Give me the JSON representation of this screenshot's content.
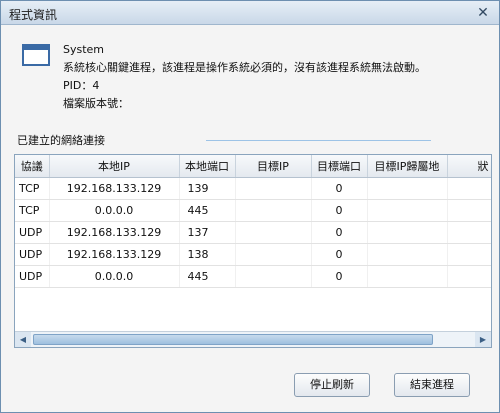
{
  "window": {
    "title": "程式資訊"
  },
  "process": {
    "name": "System",
    "description": "系統核心關鍵進程，該進程是操作系統必須的，沒有該進程系統無法啟動。",
    "pid_text": "PID：4",
    "version_label": "檔案版本號："
  },
  "connections": {
    "section_label": "已建立的網絡連接",
    "columns": [
      "協議",
      "本地IP",
      "本地端口",
      "目標IP",
      "目標端口",
      "目標IP歸屬地",
      "狀"
    ],
    "rows": [
      [
        "TCP",
        "192.168.133.129",
        "139",
        "",
        "0",
        "",
        ""
      ],
      [
        "TCP",
        "0.0.0.0",
        "445",
        "",
        "0",
        "",
        ""
      ],
      [
        "UDP",
        "192.168.133.129",
        "137",
        "",
        "0",
        "",
        ""
      ],
      [
        "UDP",
        "192.168.133.129",
        "138",
        "",
        "0",
        "",
        ""
      ],
      [
        "UDP",
        "0.0.0.0",
        "445",
        "",
        "0",
        "",
        ""
      ]
    ]
  },
  "buttons": {
    "stop_refresh": "停止刷新",
    "end_process": "結束進程"
  },
  "icons": {
    "close": "close-icon",
    "process": "window-icon"
  },
  "colors": {
    "accent": "#3a6aa5",
    "border": "#8aa4bd"
  }
}
